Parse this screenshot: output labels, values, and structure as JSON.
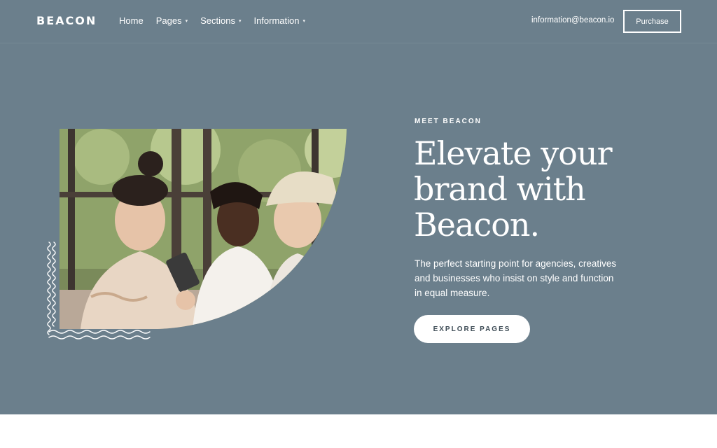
{
  "header": {
    "logo": "BEACON",
    "nav": [
      {
        "label": "Home",
        "has_dropdown": false
      },
      {
        "label": "Pages",
        "has_dropdown": true
      },
      {
        "label": "Sections",
        "has_dropdown": true
      },
      {
        "label": "Information",
        "has_dropdown": true
      }
    ],
    "email": "information@beacon.io",
    "purchase_label": "Purchase"
  },
  "hero": {
    "eyebrow": "MEET BEACON",
    "headline": "Elevate your brand with Beacon.",
    "description": "The perfect starting point for agencies, creatives and businesses who insist on style and function in equal measure.",
    "cta_label": "EXPLORE PAGES"
  },
  "colors": {
    "hero_bg": "#6b7f8c",
    "text": "#ffffff",
    "cta_text": "#3e4c56"
  },
  "icons": [
    "chevron-down-icon",
    "wave-pattern"
  ]
}
